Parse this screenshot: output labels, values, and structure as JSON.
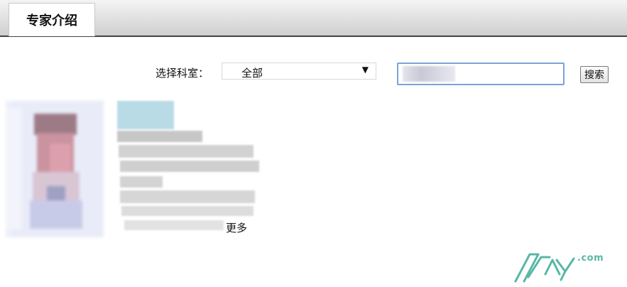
{
  "header": {
    "active_tab_label": "专家介绍"
  },
  "filter": {
    "department_label": "选择科室：",
    "department_selected": "全部",
    "dropdown_caret": "▼",
    "search_value": "",
    "search_button_label": "搜索"
  },
  "expert_card": {
    "more_label": "更多",
    "photo_icon": "avatar"
  },
  "watermark": {
    "logo_icon": "zzky-logo",
    "suffix": ".com"
  },
  "colors": {
    "search_border": "#7aa4d6",
    "header_bottom_border": "#444444",
    "watermark_color": "#58b7a5"
  }
}
